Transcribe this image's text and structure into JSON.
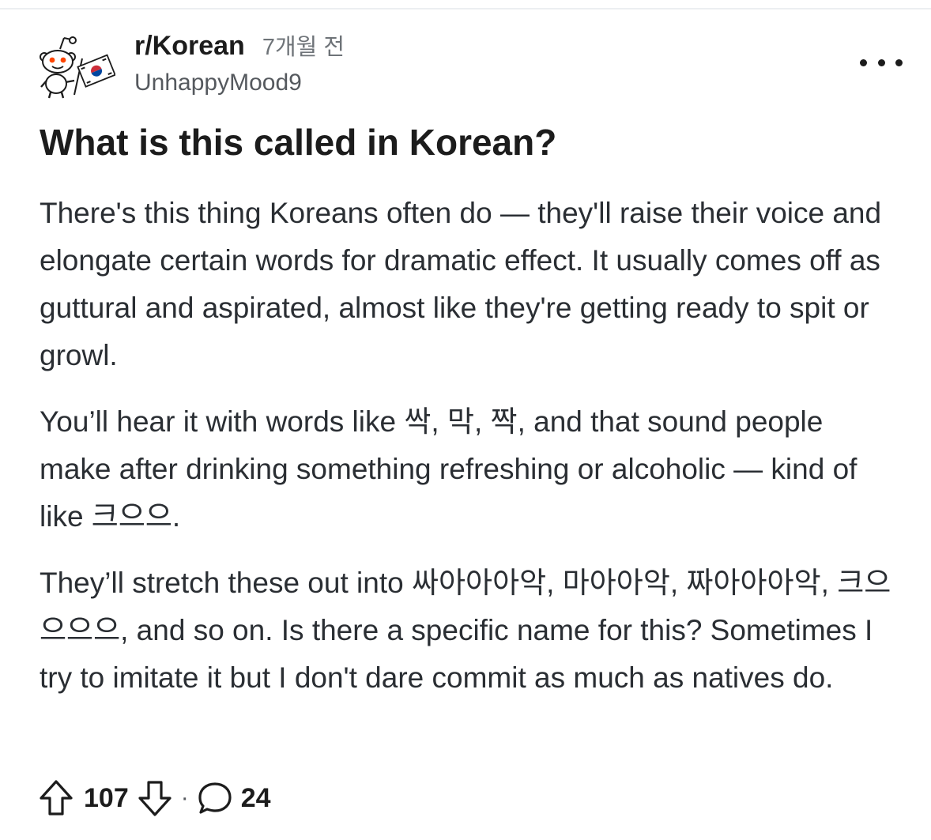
{
  "post": {
    "subreddit": "r/Korean",
    "time_ago": "7개월 전",
    "author": "UnhappyMood9",
    "title": "What is this called in Korean?",
    "paragraphs": [
      "There's this thing Koreans often do — they'll raise their voice and elongate certain words for dramatic effect. It usually comes off as guttural and aspirated, almost like they're getting ready to spit or growl.",
      "You’ll hear it with words like 싹, 막, 짝, and that sound people make after drinking something refreshing or alcoholic — kind of like 크으으.",
      "They’ll stretch these out into 싸아아아악, 마아아악, 짜아아아악, 크으으으으, and so on. Is there a specific name for this? Sometimes I try to imitate it but I don't dare commit as much as natives do."
    ],
    "votes": "107",
    "separator": "·",
    "comments": "24"
  },
  "icons": {
    "avatar": "snoo-avatar-with-korean-flag",
    "more": "more-horizontal-icon",
    "upvote": "upvote-arrow-icon",
    "downvote": "downvote-arrow-icon",
    "comment": "comment-bubble-icon"
  },
  "colors": {
    "text": "#1c1c1c",
    "muted": "#6e7378",
    "snoo_red": "#ff4500",
    "flag_red": "#cd2e3a",
    "flag_blue": "#0047a0"
  }
}
